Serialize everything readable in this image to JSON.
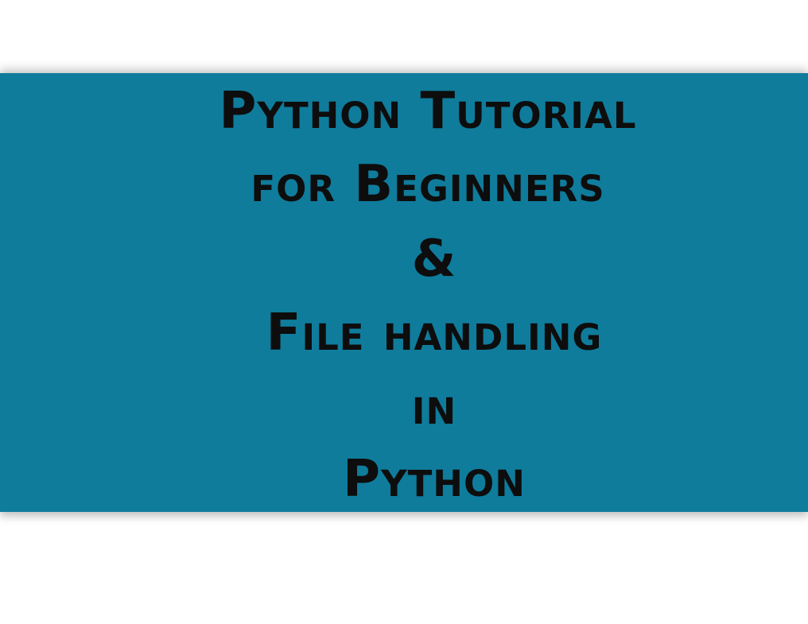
{
  "colors": {
    "background": "#ffffff",
    "banner": "#0f7c9c",
    "text": "#0d0d0d"
  },
  "title": {
    "lines": [
      "Python Tutorial",
      "for Beginners",
      "&",
      "File handling",
      "in",
      "Python"
    ]
  }
}
